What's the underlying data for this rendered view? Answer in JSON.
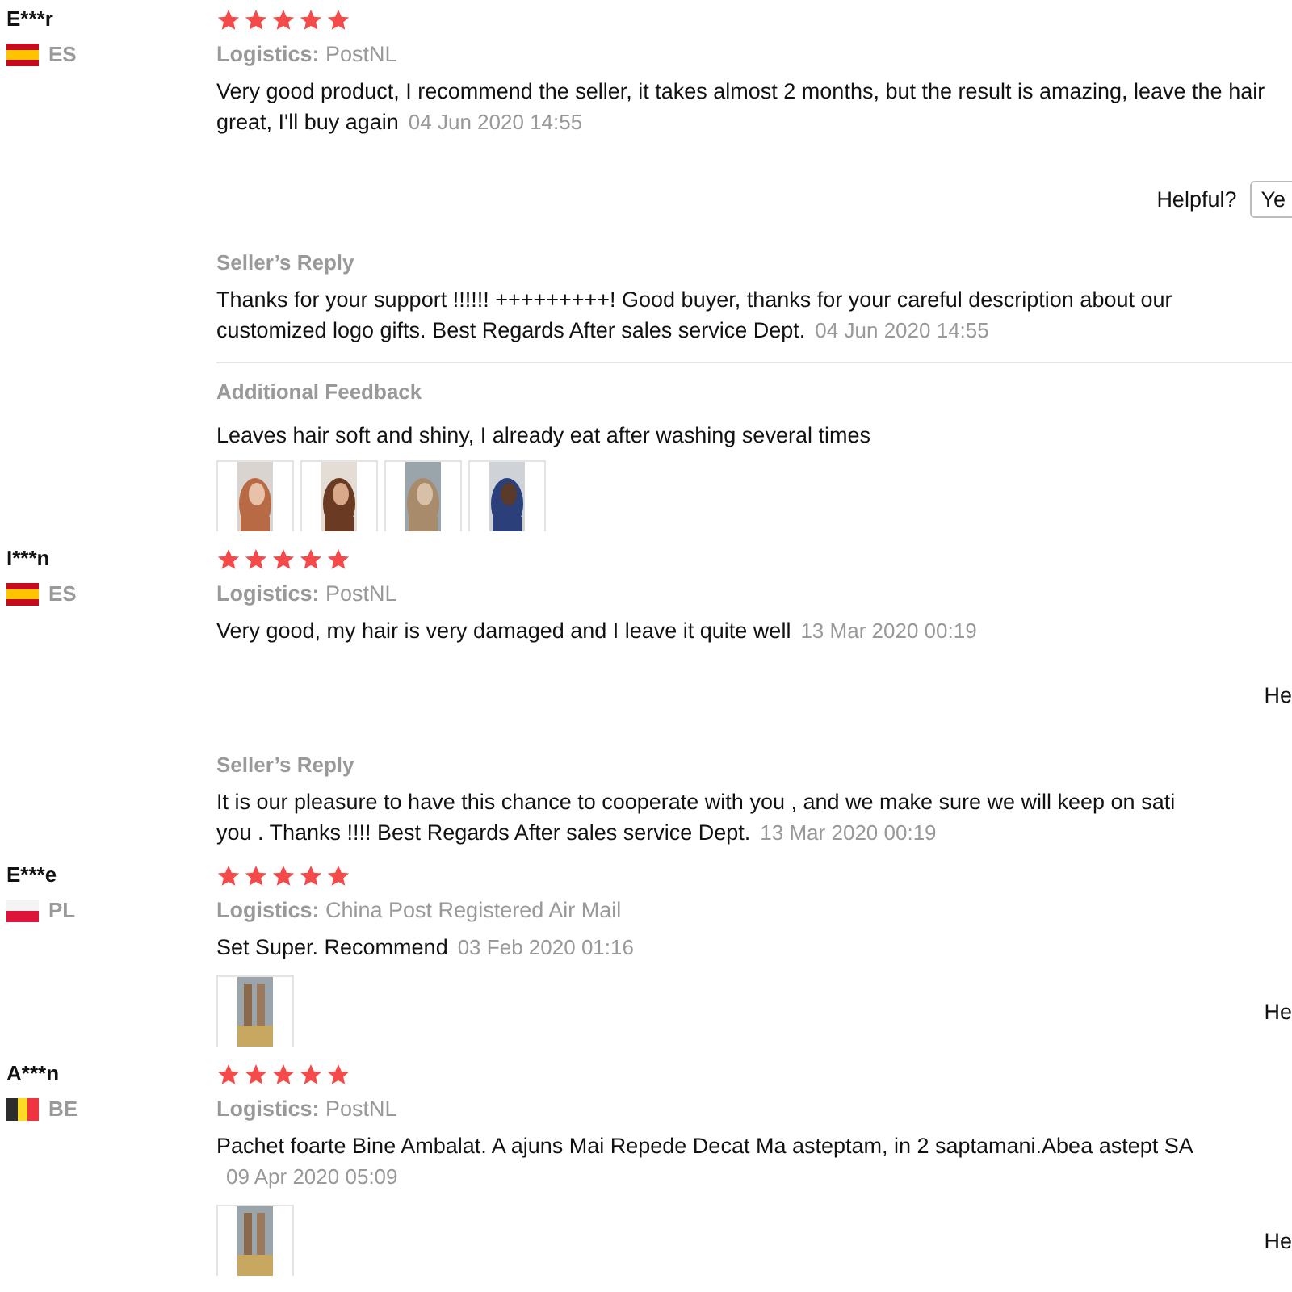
{
  "reviews": [
    {
      "name": "E***r",
      "flag": {
        "kind": "spain"
      },
      "country": "ES",
      "stars": 5,
      "logistics_label": "Logistics:",
      "logistics": "PostNL",
      "text": "Very good product, I recommend the seller, it takes almost 2 months, but the result is amazing, leave the hair\ngreat, I'll buy again",
      "date": "04 Jun 2020 14:55",
      "helpful": {
        "label": "Helpful?",
        "button": "Ye"
      },
      "reply": {
        "title": "Seller’s Reply",
        "text": "Thanks for your support !!!!!! +++++++++! Good buyer, thanks for your careful description about our\ncustomized logo gifts. Best Regards After sales service Dept.",
        "date": "04 Jun 2020 14:55"
      },
      "additional": {
        "title": "Additional Feedback",
        "text": "Leaves hair soft and shiny, I already eat after washing several times",
        "photos": [
          {
            "kind": "picture"
          },
          {
            "kind": "picture"
          },
          {
            "kind": "picture"
          },
          {
            "kind": "picture"
          }
        ]
      }
    },
    {
      "name": "I***n",
      "flag": {
        "kind": "spain"
      },
      "country": "ES",
      "stars": 5,
      "logistics_label": "Logistics:",
      "logistics": "PostNL",
      "text": "Very good, my hair is very damaged and I leave it quite well",
      "date": "13 Mar 2020 00:19",
      "helpful": {
        "label": "He"
      },
      "reply": {
        "title": "Seller’s Reply",
        "text": "It is our pleasure to have this chance to cooperate with you , and we make sure we will keep on sati\nyou . Thanks !!!! Best Regards After sales service Dept.",
        "date": "13 Mar 2020 00:19"
      }
    },
    {
      "name": "E***e",
      "flag": {
        "kind": "poland"
      },
      "country": "PL",
      "stars": 5,
      "logistics_label": "Logistics:",
      "logistics": "China Post Registered Air Mail",
      "text": "Set Super. Recommend",
      "date": "03 Feb 2020 01:16",
      "photos": [
        {
          "kind": "picture"
        }
      ],
      "helpful": {
        "label": "He"
      }
    },
    {
      "name": "A***n",
      "flag": {
        "kind": "belgium"
      },
      "country": "BE",
      "stars": 5,
      "logistics_label": "Logistics:",
      "logistics": "PostNL",
      "text": "Pachet foarte Bine Ambalat. A ajuns Mai Repede Decat Ma asteptam, in 2 saptamani.Abea astept SA\n",
      "date": "09 Apr 2020 05:09",
      "photos": [
        {
          "kind": "picture"
        }
      ],
      "helpful": {
        "label": "He"
      }
    }
  ]
}
